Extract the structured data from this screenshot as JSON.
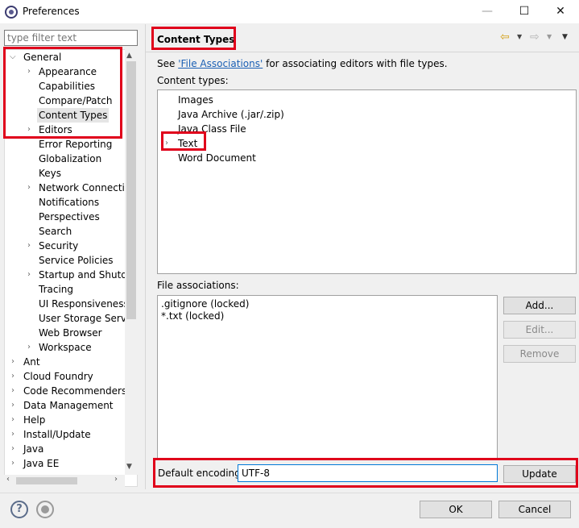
{
  "window": {
    "title": "Preferences",
    "minimize": "—",
    "maximize": "☐",
    "close": "✕"
  },
  "filter": {
    "placeholder": "type filter text"
  },
  "tree": {
    "general": "General",
    "children": [
      "Appearance",
      "Capabilities",
      "Compare/Patch",
      "Content Types",
      "Editors",
      "Error Reporting",
      "Globalization",
      "Keys",
      "Network Connection",
      "Notifications",
      "Perspectives",
      "Search",
      "Security",
      "Service Policies",
      "Startup and Shutdown",
      "Tracing",
      "UI Responsiveness M",
      "User Storage Service",
      "Web Browser",
      "Workspace"
    ],
    "top_level": [
      "Ant",
      "Cloud Foundry",
      "Code Recommenders",
      "Data Management",
      "Help",
      "Install/Update",
      "Java",
      "Java EE"
    ]
  },
  "page": {
    "title": "Content Types",
    "see_prefix": "See ",
    "see_link": "'File Associations'",
    "see_suffix": " for associating editors with file types.",
    "content_types_label": "Content types:",
    "content_types": [
      "Images",
      "Java Archive (.jar/.zip)",
      "Java Class File",
      "Text",
      "Word Document"
    ],
    "file_assoc_label": "File associations:",
    "file_assocs": [
      ".gitignore (locked)",
      "*.txt (locked)"
    ],
    "add_button": "Add...",
    "edit_button": "Edit...",
    "remove_button": "Remove",
    "encoding_label": "Default encoding:",
    "encoding_value": "UTF-8",
    "update_button": "Update"
  },
  "footer": {
    "ok": "OK",
    "cancel": "Cancel",
    "help_glyph": "?"
  },
  "annotation_color": "#e0001b"
}
